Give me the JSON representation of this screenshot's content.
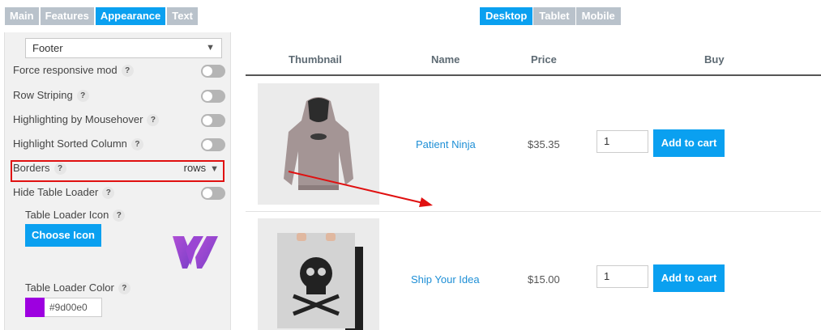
{
  "tabs": [
    {
      "label": "Main",
      "active": false
    },
    {
      "label": "Features",
      "active": false
    },
    {
      "label": "Appearance",
      "active": true
    },
    {
      "label": "Text",
      "active": false
    }
  ],
  "device_tabs": [
    {
      "label": "Desktop",
      "active": true
    },
    {
      "label": "Tablet",
      "active": false
    },
    {
      "label": "Mobile",
      "active": false
    }
  ],
  "settings": {
    "footer_select": "Footer",
    "force_responsive": {
      "label": "Force responsive mod",
      "enabled": false
    },
    "row_striping": {
      "label": "Row Striping",
      "enabled": false
    },
    "highlight_hover": {
      "label": "Highlighting by Mousehover",
      "enabled": false
    },
    "highlight_sorted": {
      "label": "Highlight Sorted Column",
      "enabled": false
    },
    "borders": {
      "label": "Borders",
      "value": "rows"
    },
    "hide_loader": {
      "label": "Hide Table Loader",
      "enabled": false
    },
    "loader_icon": {
      "label": "Table Loader Icon",
      "button": "Choose Icon"
    },
    "loader_color": {
      "label": "Table Loader Color",
      "value": "#9d00e0"
    },
    "help_glyph": "?"
  },
  "table": {
    "headers": [
      "Thumbnail",
      "Name",
      "Price",
      "Buy"
    ],
    "rows": [
      {
        "name": "Patient Ninja",
        "price": "$35.35",
        "qty": "1",
        "button": "Add to cart"
      },
      {
        "name": "Ship Your Idea",
        "price": "$15.00",
        "qty": "1",
        "button": "Add to cart"
      }
    ]
  },
  "colors": {
    "accent": "#0aa0f0",
    "tab_inactive": "#b9c2cb",
    "highlight_border": "#e01010",
    "loader_color": "#9d00e0"
  },
  "icons": {
    "caret": "▼"
  }
}
